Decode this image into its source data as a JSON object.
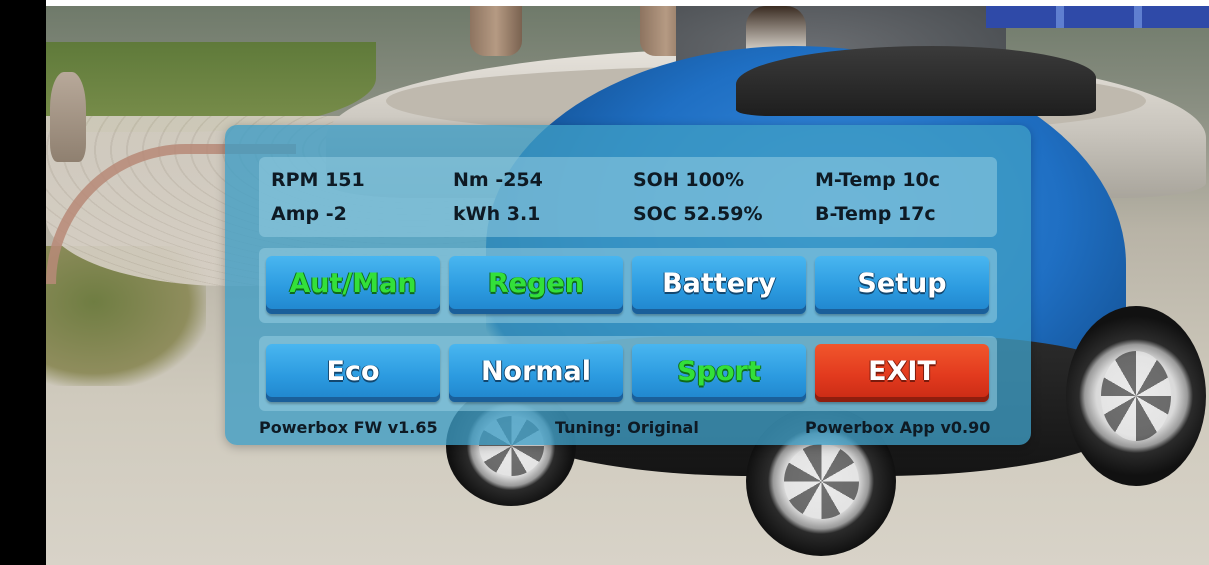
{
  "stats": {
    "rpm": "RPM 151",
    "nm": "Nm -254",
    "soh": "SOH 100%",
    "mtemp": "M-Temp 10c",
    "amp": "Amp -2",
    "kwh": "kWh 3.1",
    "soc": "SOC 52.59%",
    "btemp": "B-Temp 17c"
  },
  "menu_buttons": {
    "aut_man": "Aut/Man",
    "regen": "Regen",
    "battery": "Battery",
    "setup": "Setup"
  },
  "mode_buttons": {
    "eco": "Eco",
    "normal": "Normal",
    "sport": "Sport",
    "exit": "EXIT"
  },
  "footer": {
    "firmware": "Powerbox FW v1.65",
    "tuning": "Tuning: Original",
    "app_version": "Powerbox App v0.90"
  },
  "colors": {
    "panel": "#3e9cc4",
    "button": "#2c9be0",
    "active_text": "#33e03a",
    "exit_button": "#e23a1e"
  }
}
